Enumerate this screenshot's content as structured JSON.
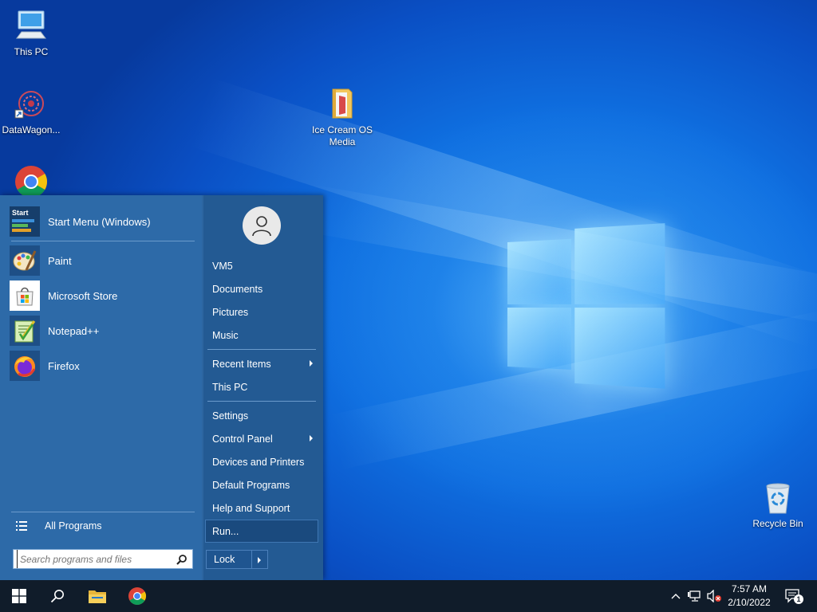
{
  "desktop": {
    "icons": [
      {
        "label": "This PC",
        "icon": "computer-icon"
      },
      {
        "label": "DataWagon...",
        "icon": "datawagon-icon"
      },
      {
        "label": "Ice  Cream OS Media",
        "icon": "folder-icon"
      },
      {
        "label": "Recycle Bin",
        "icon": "recycle-bin-icon"
      },
      {
        "label": "",
        "icon": "chrome-icon"
      }
    ]
  },
  "start_menu": {
    "pinned": [
      {
        "label": "Start Menu (Windows)",
        "icon": "start-menu-icon"
      },
      {
        "label": "Paint",
        "icon": "paint-icon"
      },
      {
        "label": "Microsoft Store",
        "icon": "store-icon"
      },
      {
        "label": "Notepad++",
        "icon": "notepadpp-icon"
      },
      {
        "label": "Firefox",
        "icon": "firefox-icon"
      }
    ],
    "start_icon_text": "Start",
    "all_programs": "All Programs",
    "search_placeholder": "Search programs and files",
    "right": {
      "user": "VM5",
      "documents": "Documents",
      "pictures": "Pictures",
      "music": "Music",
      "recent_items": "Recent Items",
      "this_pc": "This PC",
      "settings": "Settings",
      "control_panel": "Control Panel",
      "devices_printers": "Devices and Printers",
      "default_programs": "Default Programs",
      "help_support": "Help and Support",
      "run": "Run..."
    },
    "lock": "Lock"
  },
  "taskbar": {
    "time": "7:57 AM",
    "date": "2/10/2022",
    "notification_count": "1",
    "apps": [
      "windows-start-icon",
      "search-icon",
      "file-explorer-icon",
      "chrome-icon"
    ]
  },
  "colors": {
    "start_menu_left": "#2d6aa8",
    "start_menu_right": "#235a93",
    "taskbar": "#101c2a",
    "desktop_accent": "#0f6fe0"
  }
}
